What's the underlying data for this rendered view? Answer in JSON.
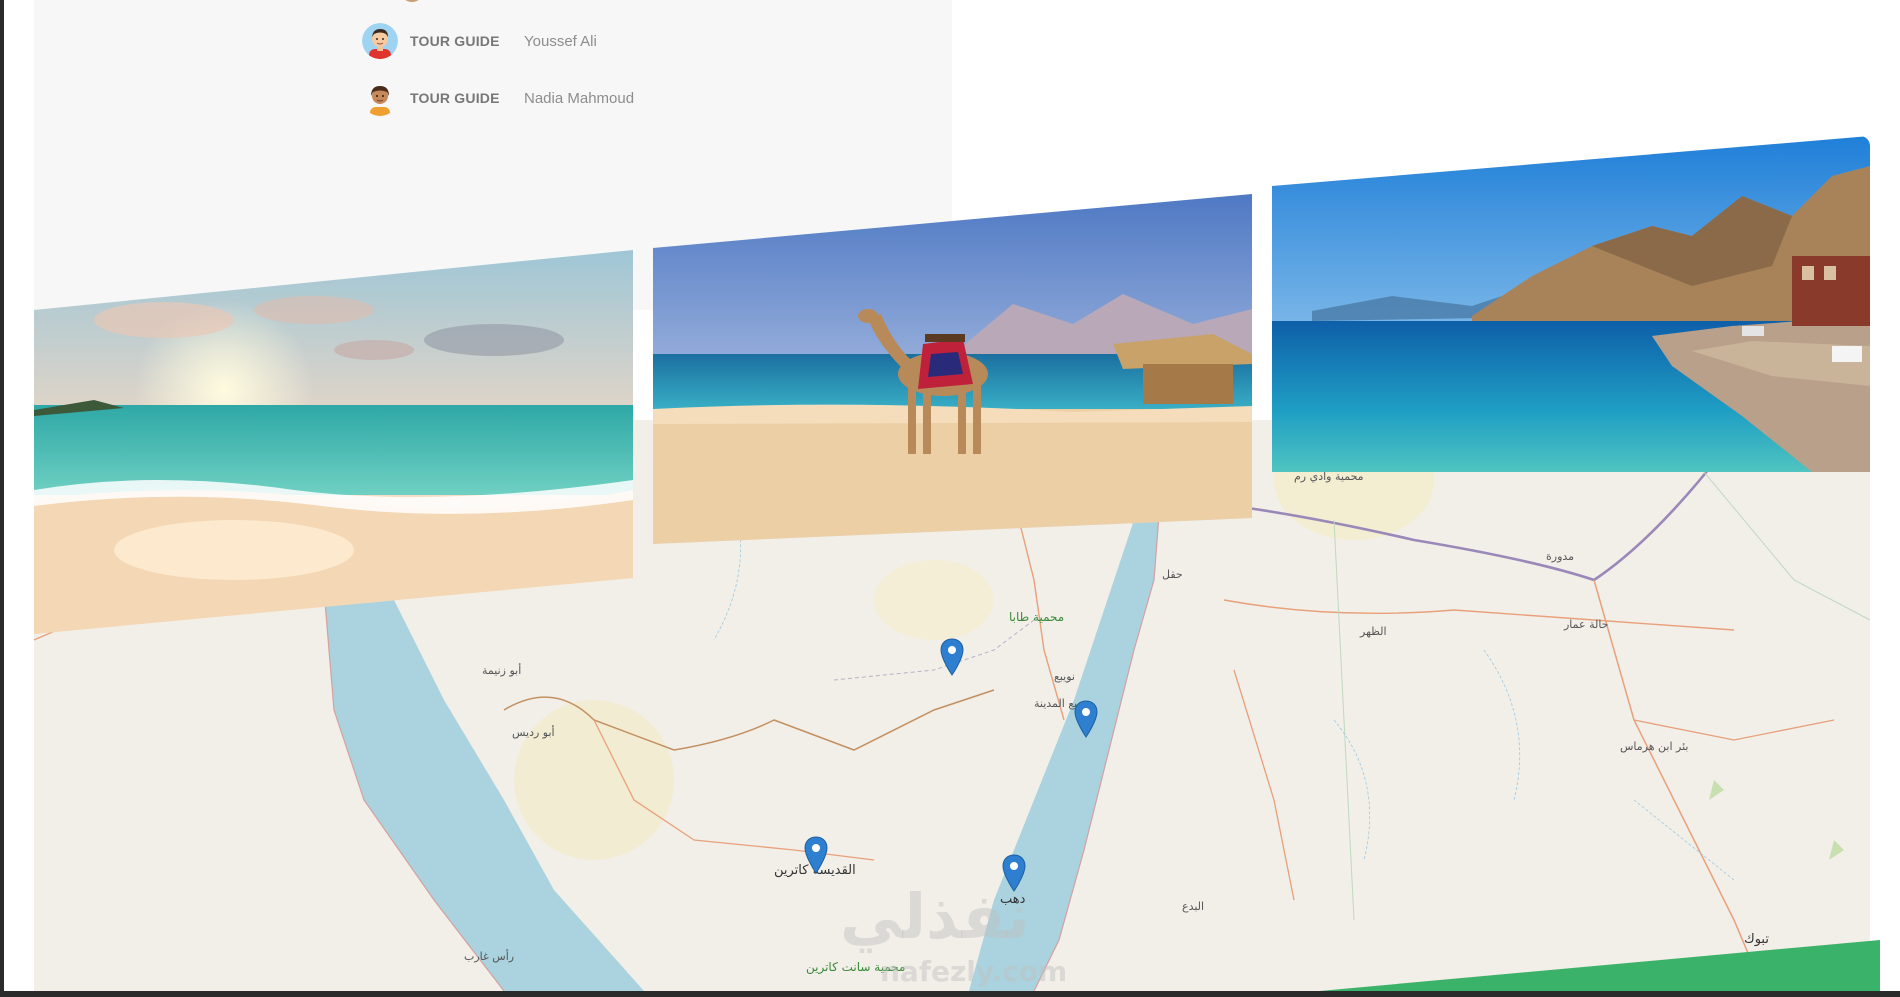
{
  "guides": [
    {
      "role": "TOUR GUIDE",
      "name": "Youssef Ali",
      "avatar_icon": "boy-avatar-icon"
    },
    {
      "role": "TOUR GUIDE",
      "name": "Nadia Mahmoud",
      "avatar_icon": "girl-avatar-icon"
    }
  ],
  "photos": [
    {
      "subject": "beach-sunset-photo"
    },
    {
      "subject": "camel-beach-photo"
    },
    {
      "subject": "coastal-mountains-photo"
    }
  ],
  "map": {
    "labels": {
      "taba": "محمية طابا",
      "nuweiba": "نويبع",
      "nuweiba_city": "نويبع المدينة",
      "haql": "حقل",
      "abu_zenima": "أبو زنيمة",
      "abu_rudeis": "أبو رديس",
      "catherine": "القديسة كاترين",
      "dahab": "دهب",
      "st_catherine_reserve": "محمية سانت كاترين",
      "ras_gharib": "رأس غارب",
      "bada": "البدع",
      "dhahr": "الظهر",
      "madawra": "مدورة",
      "halat_ammar": "حالة عمار",
      "bir_ibn_hirmas": "بئر ابن هرماس",
      "tabuk": "تبوك",
      "wadi_rum": "محمية وادي رم"
    },
    "marker_color": "#2f7fd0",
    "water_color": "#aad3df"
  },
  "watermark": {
    "main": "نفذلي",
    "sub": "nafezly.com"
  },
  "accent_color": "#3bb26a"
}
